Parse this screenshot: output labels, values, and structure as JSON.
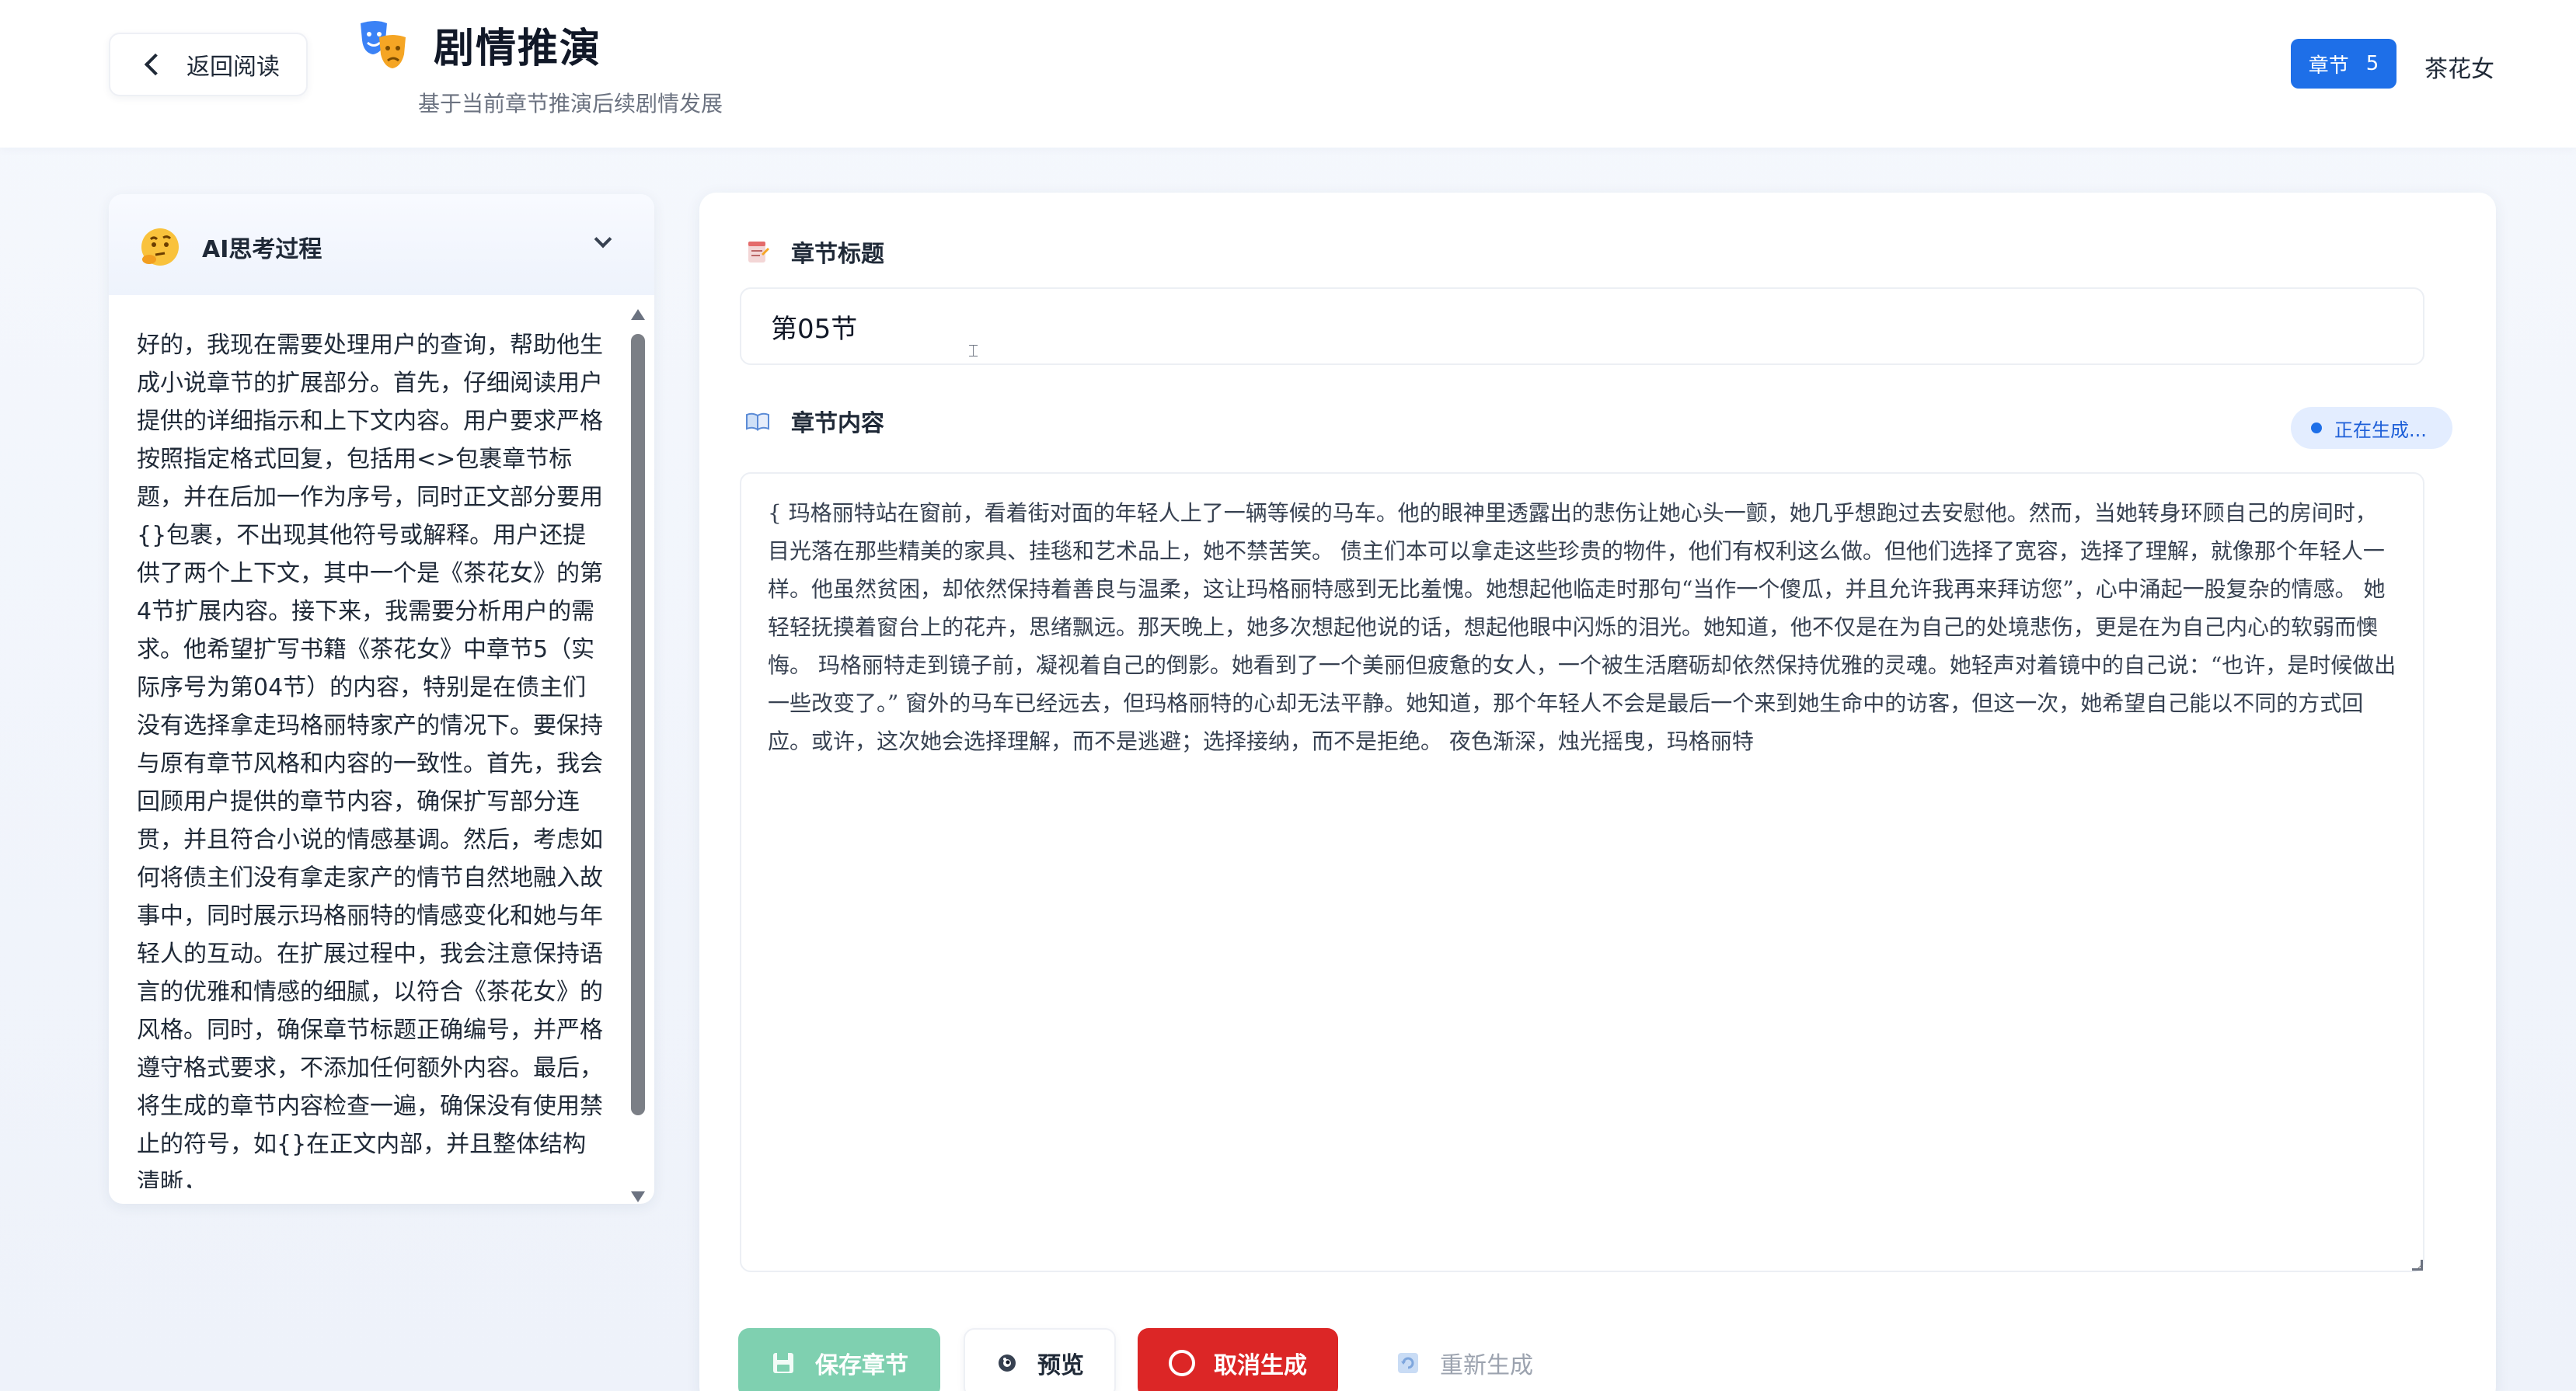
{
  "header": {
    "back_label": "返回阅读",
    "title": "剧情推演",
    "subtitle": "基于当前章节推演后续剧情发展",
    "chapter_badge_label": "章节",
    "chapter_badge_number": "5",
    "book_name": "茶花女"
  },
  "thinking": {
    "title": "AI思考过程",
    "text": "好的，我现在需要处理用户的查询，帮助他生成小说章节的扩展部分。首先，仔细阅读用户提供的详细指示和上下文内容。用户要求严格按照指定格式回复，包括用<>包裹章节标题，并在后加一作为序号，同时正文部分要用{}包裹，不出现其他符号或解释。用户还提供了两个上下文，其中一个是《茶花女》的第4节扩展内容。接下来，我需要分析用户的需求。他希望扩写书籍《茶花女》中章节5（实际序号为第04节）的内容，特别是在债主们没有选择拿走玛格丽特家产的情况下。要保持与原有章节风格和内容的一致性。首先，我会回顾用户提供的章节内容，确保扩写部分连贯，并且符合小说的情感基调。然后，考虑如何将债主们没有拿走家产的情节自然地融入故事中，同时展示玛格丽特的情感变化和她与年轻人的互动。在扩展过程中，我会注意保持语言的优雅和情感的细腻，以符合《茶花女》的风格。同时，确保章节标题正确编号，并严格遵守格式要求，不添加任何额外内容。最后，将生成的章节内容检查一遍，确保没有使用禁止的符号，如{}在正文内部，并且整体结构清晰，"
  },
  "editor": {
    "title_label": "章节标题",
    "title_value": "第05节",
    "content_label": "章节内容",
    "status": "正在生成...",
    "content": "{ 玛格丽特站在窗前，看着街对面的年轻人上了一辆等候的马车。他的眼神里透露出的悲伤让她心头一颤，她几乎想跑过去安慰他。然而，当她转身环顾自己的房间时，目光落在那些精美的家具、挂毯和艺术品上，她不禁苦笑。 债主们本可以拿走这些珍贵的物件，他们有权利这么做。但他们选择了宽容，选择了理解，就像那个年轻人一样。他虽然贫困，却依然保持着善良与温柔，这让玛格丽特感到无比羞愧。她想起他临走时那句“当作一个傻瓜，并且允许我再来拜访您”，心中涌起一股复杂的情感。 她轻轻抚摸着窗台上的花卉，思绪飘远。那天晚上，她多次想起他说的话，想起他眼中闪烁的泪光。她知道，他不仅是在为自己的处境悲伤，更是在为自己内心的软弱而懊悔。 玛格丽特走到镜子前，凝视着自己的倒影。她看到了一个美丽但疲惫的女人，一个被生活磨砺却依然保持优雅的灵魂。她轻声对着镜中的自己说：“也许，是时候做出一些改变了。” 窗外的马车已经远去，但玛格丽特的心却无法平静。她知道，那个年轻人不会是最后一个来到她生命中的访客，但这一次，她希望自己能以不同的方式回应。或许，这次她会选择理解，而不是逃避；选择接纳，而不是拒绝。 夜色渐深，烛光摇曳，玛格丽特"
  },
  "actions": {
    "save": "保存章节",
    "preview": "预览",
    "cancel": "取消生成",
    "regenerate": "重新生成"
  },
  "colors": {
    "primary": "#1e6fe8",
    "save_button": "#7fd0b0",
    "cancel_button": "#dc2626",
    "status_pill_bg": "#e3edff"
  },
  "icons": {
    "back": "chevron-left-icon",
    "header": "theater-masks-icon",
    "thinking": "thinking-face-icon",
    "collapse": "chevron-down-icon",
    "title": "memo-icon",
    "content": "open-book-icon",
    "save": "floppy-disk-icon",
    "preview": "eye-icon",
    "cancel": "stop-circle-icon",
    "regenerate": "refresh-icon"
  }
}
